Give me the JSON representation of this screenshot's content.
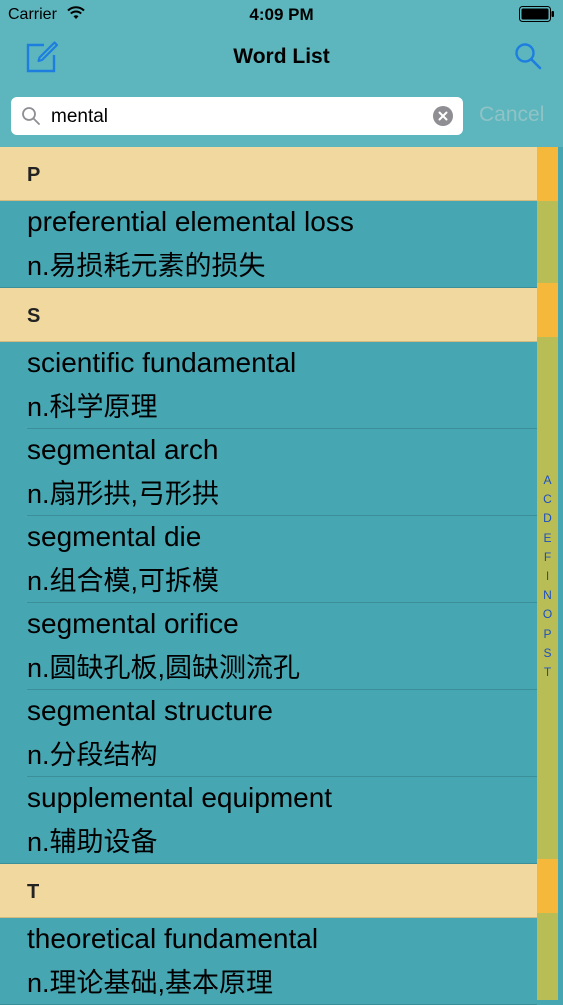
{
  "status": {
    "carrier": "Carrier",
    "time": "4:09 PM"
  },
  "nav": {
    "title": "Word List",
    "left_icon": "compose-icon",
    "right_icon": "search-icon"
  },
  "search": {
    "value": "mental",
    "cancel_label": "Cancel"
  },
  "sections": [
    {
      "header": "P",
      "rows": [
        {
          "term": "preferential elemental loss",
          "meaning": "n.易损耗元素的损失"
        }
      ]
    },
    {
      "header": "S",
      "rows": [
        {
          "term": "scientific fundamental",
          "meaning": "n.科学原理"
        },
        {
          "term": "segmental arch",
          "meaning": "n.扇形拱,弓形拱"
        },
        {
          "term": "segmental die",
          "meaning": "n.组合模,可拆模"
        },
        {
          "term": "segmental orifice",
          "meaning": "n.圆缺孔板,圆缺测流孔"
        },
        {
          "term": "segmental structure",
          "meaning": "n.分段结构"
        },
        {
          "term": "supplemental equipment",
          "meaning": "n.辅助设备"
        }
      ]
    },
    {
      "header": "T",
      "rows": [
        {
          "term": "theoretical fundamental",
          "meaning": "n.理论基础,基本原理"
        }
      ]
    }
  ],
  "index_letters": [
    "A",
    "C",
    "D",
    "E",
    "F",
    "I",
    "N",
    "O",
    "P",
    "S",
    "T"
  ],
  "colors": {
    "list_background": "#46a6b2",
    "bar_background": "#5db6bd",
    "section_header": "#f0d89e",
    "accent_blue": "#1e7ee0",
    "index_bar": "#b9bd55",
    "index_accent": "#f6b83b"
  }
}
